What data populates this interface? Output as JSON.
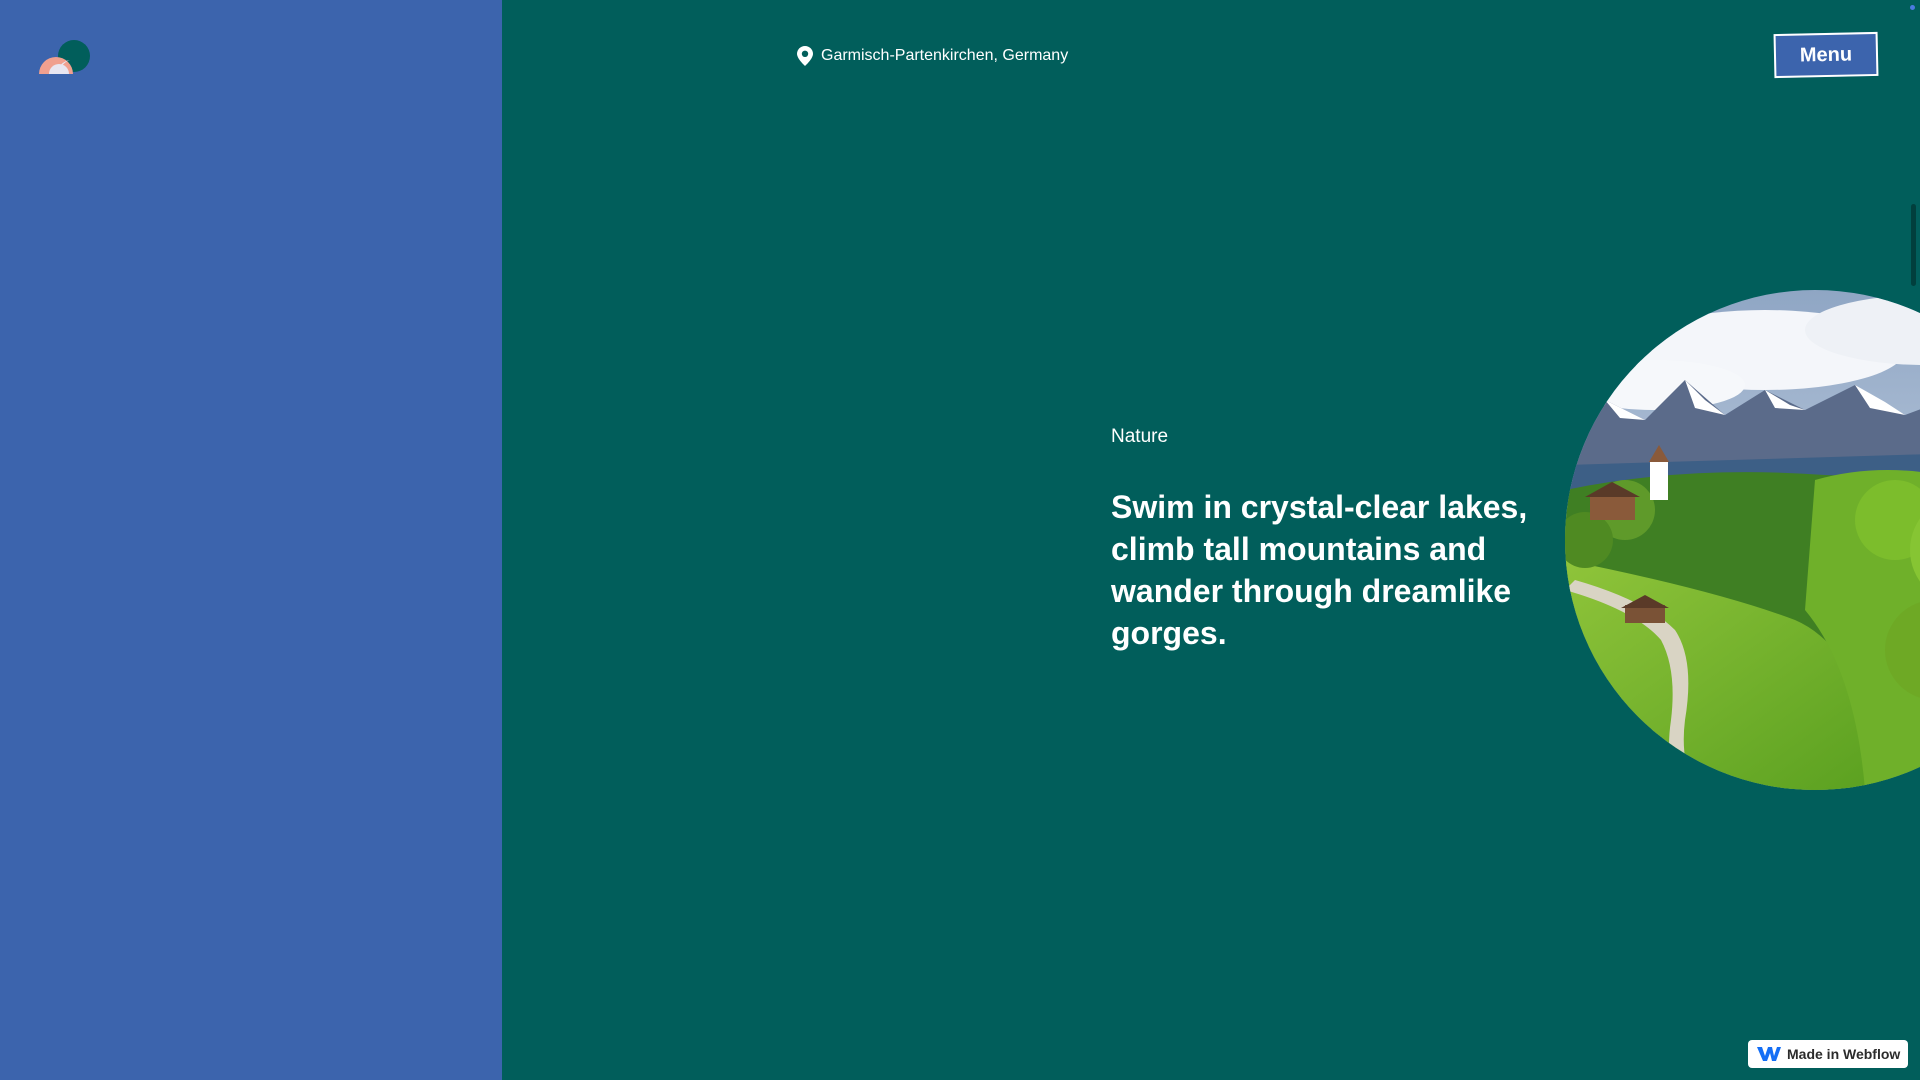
{
  "header": {
    "location_text": "Garmisch-Partenkirchen, Germany",
    "location_icon": "map-pin-icon",
    "menu_label": "Menu"
  },
  "hero": {
    "category": "Nature",
    "headline": "Swim in crystal-clear lakes, climb tall mountains and wander through dreamlike gorges."
  },
  "badge": {
    "label": "Made in Webflow",
    "icon": "webflow-logo-icon"
  },
  "colors": {
    "left_panel": "#3c64ad",
    "main_background": "#015e5b",
    "menu_button": "#3c64ad",
    "text": "#ffffff"
  }
}
